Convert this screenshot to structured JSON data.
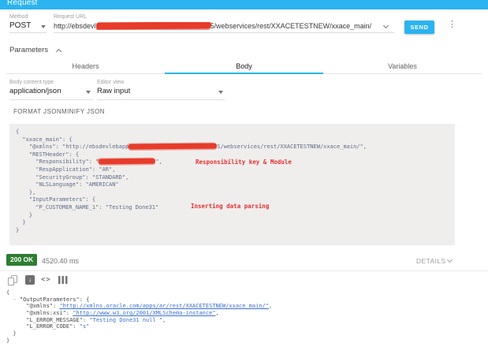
{
  "colors": {
    "accent": "#2bb3f0",
    "status_green": "#2e7d32",
    "annotation_red": "#e53030"
  },
  "header": {
    "title": "Request"
  },
  "icons": {
    "kebab": "⋮",
    "save_arrow": "↓",
    "code": "<>"
  },
  "request": {
    "method_label": "Method",
    "method_value": "POST",
    "url_label": "Request URL",
    "url_prefix": "http://ebsdevl",
    "url_suffix": "5/webservices/rest/XXACETESTNEW/xxace_main/",
    "send_label": "SEND"
  },
  "parameters_label": "Parameters",
  "tabs": [
    {
      "label": "Headers",
      "active": false
    },
    {
      "label": "Body",
      "active": true
    },
    {
      "label": "Variables",
      "active": false
    }
  ],
  "body_panel": {
    "content_type_label": "Body content type",
    "content_type_value": "application/json",
    "editor_view_label": "Editor view",
    "editor_view_value": "Raw input",
    "format_button": "FORMAT JSON",
    "minify_button": "MINIFY JSON",
    "code_lines": [
      [
        {
          "t": "{"
        }
      ],
      [
        {
          "t": "  \"xxace_main\": {"
        }
      ],
      [
        {
          "t": "    \"@xmlns\": \"http://ebsdevlebapp"
        },
        {
          "redact": 112
        },
        {
          "t": "S/webservices/rest/XXACETESTNEW/xxace_main/\","
        }
      ],
      [
        {
          "t": "    \"RESTHeader\": {"
        }
      ],
      [
        {
          "t": "      \"Responsibility\": \""
        },
        {
          "redact": 72
        },
        {
          "t": "\","
        }
      ],
      [
        {
          "t": "      \"RespApplication\": \"AR\","
        }
      ],
      [
        {
          "t": "      \"SecurityGroup\": \"STANDARD\","
        }
      ],
      [
        {
          "t": "      \"NLSLanguage\": \"AMERICAN\""
        }
      ],
      [
        {
          "t": "    },"
        }
      ],
      [
        {
          "t": "    \"InputParameters\": {"
        }
      ],
      [
        {
          "t": "      \"P_CUSTOMER_NAME_1\": \"Testing Done31\""
        }
      ],
      [
        {
          "t": "    }"
        }
      ],
      [
        {
          "t": "  }"
        }
      ],
      [
        {
          "t": "}"
        }
      ]
    ],
    "annotations": [
      {
        "text": "Responsibility key & Module"
      },
      {
        "text": "Inserting data parsing"
      }
    ]
  },
  "response": {
    "status": "200 OK",
    "time": "4520.40 ms",
    "details_label": "DETAILS",
    "body_lines": [
      [
        {
          "t": "{",
          "c": "p"
        }
      ],
      [
        {
          "t": "  ",
          "c": "p"
        },
        {
          "t": "-",
          "c": "tg"
        },
        {
          "t": " ",
          "c": "p"
        },
        {
          "t": "\"OutputParameters\": {",
          "c": "k"
        }
      ],
      [
        {
          "t": "      ",
          "c": "p"
        },
        {
          "t": "\"@xmlns\"",
          "c": "k"
        },
        {
          "t": ": ",
          "c": "p"
        },
        {
          "t": "\"http://xmlns.oracle.com/apps/ar/rest/XXACETESTNEW/xxace_main/\"",
          "c": "l"
        },
        {
          "t": ",",
          "c": "p"
        }
      ],
      [
        {
          "t": "      ",
          "c": "p"
        },
        {
          "t": "\"@xmlns:xsi\"",
          "c": "k"
        },
        {
          "t": ": ",
          "c": "p"
        },
        {
          "t": "\"http://www.w3.org/2001/XMLSchema-instance\"",
          "c": "l"
        },
        {
          "t": ",",
          "c": "p"
        }
      ],
      [
        {
          "t": "      ",
          "c": "p"
        },
        {
          "t": "\"L_ERROR_MESSAGE\"",
          "c": "k"
        },
        {
          "t": ": ",
          "c": "p"
        },
        {
          "t": "\"Testing Done31 null \"",
          "c": "v"
        },
        {
          "t": ",",
          "c": "p"
        }
      ],
      [
        {
          "t": "      ",
          "c": "p"
        },
        {
          "t": "\"L_ERROR_CODE\"",
          "c": "k"
        },
        {
          "t": ": ",
          "c": "p"
        },
        {
          "t": "\"s\"",
          "c": "v"
        }
      ],
      [
        {
          "t": "  }",
          "c": "p"
        }
      ],
      [
        {
          "t": "}",
          "c": "p"
        }
      ]
    ]
  }
}
